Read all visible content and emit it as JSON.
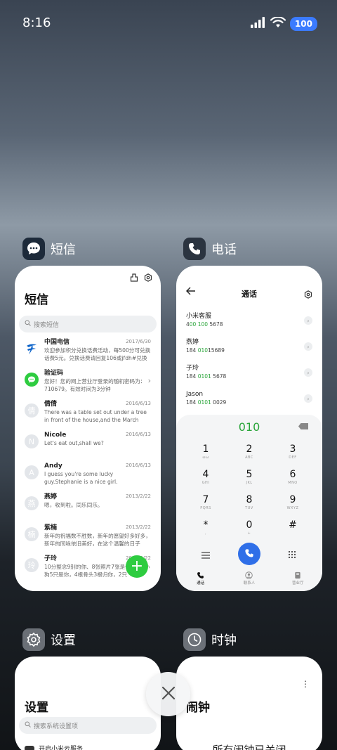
{
  "status_bar": {
    "time": "8:16",
    "battery": "100"
  },
  "apps": {
    "sms": {
      "name": "短信"
    },
    "phone": {
      "name": "电话"
    },
    "settings": {
      "name": "设置"
    },
    "clock": {
      "name": "时钟"
    }
  },
  "sms_card": {
    "title": "短信",
    "search_placeholder": "搜索短信",
    "messages": [
      {
        "name": "中国电信",
        "date": "2017/6/30",
        "text": "欢迎参加积分兑换话费活动，每500分可兑换话费5元。兑换话费请回复106或jfdh#兑换",
        "avatar": ""
      },
      {
        "name": "验证码",
        "date": "",
        "text": "您好！您的网上营业厅登录的随机密码为：710679。有效时间为3分钟",
        "avatar": ""
      },
      {
        "name": "倩倩",
        "date": "2016/6/13",
        "text": "There was a table set out under a tree in front of the house,and the March Hare and...",
        "avatar": "倩"
      },
      {
        "name": "Nicole",
        "date": "2016/6/13",
        "text": "Let's eat out,shall we?",
        "avatar": "N"
      },
      {
        "name": "Andy",
        "date": "2016/6/13",
        "text": "I guess you're some lucky guy.Stephanie is a nice girl.",
        "avatar": "A"
      },
      {
        "name": "燕婷",
        "date": "2013/2/22",
        "text": "嗯，收到啦。同乐同乐。",
        "avatar": "燕"
      },
      {
        "name": "紫楠",
        "date": "2013/2/22",
        "text": "新年的祝福数不胜数，新年的愿望好多好多，新年的同咏依旧美好，在这个温馨的日子",
        "avatar": "楠"
      },
      {
        "name": "子玲",
        "date": "2013/2/22",
        "text": "10分整念9别的你、8张照片7张是你，6只小狗5只是你，4根骨头3根归你，2只",
        "avatar": "玲"
      }
    ]
  },
  "phone_card": {
    "title": "通话",
    "contacts": [
      {
        "name": "小米客服",
        "num_pre": "4",
        "num_hl": "00 100",
        "num_post": " 5678"
      },
      {
        "name": "燕婷",
        "num_pre": "184 ",
        "num_hl": "010",
        "num_post": "15689"
      },
      {
        "name": "子玲",
        "num_pre": "184 ",
        "num_hl": "0101",
        "num_post": " 5678"
      },
      {
        "name": "Jason",
        "num_pre": "184 ",
        "num_hl": "0101",
        "num_post": " 0029"
      }
    ],
    "dial_number": "010",
    "keys": [
      {
        "d": "1",
        "l": "ωω"
      },
      {
        "d": "2",
        "l": "ABC"
      },
      {
        "d": "3",
        "l": "DEF"
      },
      {
        "d": "4",
        "l": "GHI"
      },
      {
        "d": "5",
        "l": "JKL"
      },
      {
        "d": "6",
        "l": "MNO"
      },
      {
        "d": "7",
        "l": "PQRS"
      },
      {
        "d": "8",
        "l": "TUV"
      },
      {
        "d": "9",
        "l": "WXYZ"
      },
      {
        "d": "*",
        "l": ","
      },
      {
        "d": "0",
        "l": "+"
      },
      {
        "d": "#",
        "l": ""
      }
    ],
    "nav": {
      "calls": "通话",
      "contacts": "联系人",
      "store": "营业厅"
    }
  },
  "settings_card": {
    "title": "设置",
    "search_placeholder": "搜索系统设置项",
    "first_item": "开启小米云服务"
  },
  "clock_card": {
    "title": "闹钟",
    "empty_text": "所有闹钟已关闭"
  },
  "colors": {
    "accent_green": "#2aa53a",
    "call_blue": "#2f6fe8",
    "battery_blue": "#3b7bff"
  }
}
